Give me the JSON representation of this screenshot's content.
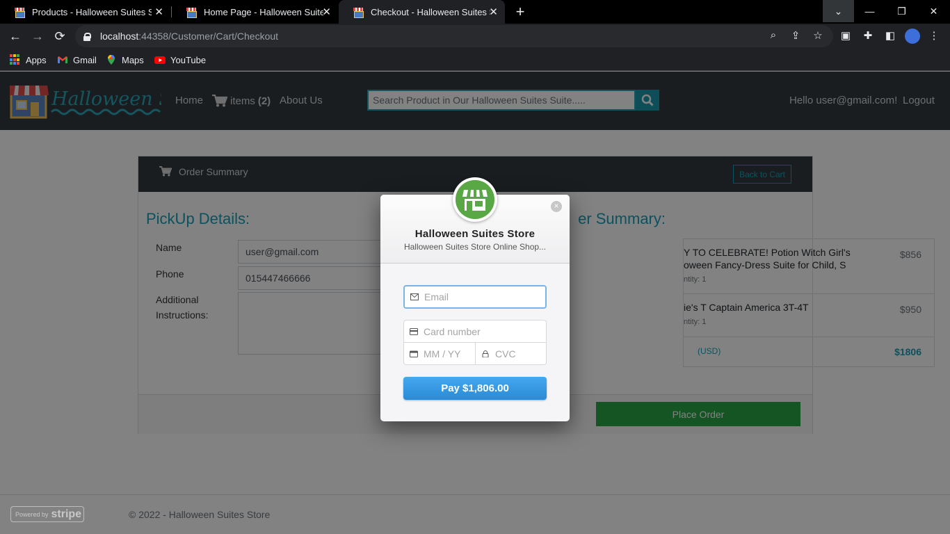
{
  "browser": {
    "tabs": [
      {
        "title": "Products - Halloween Suites Store"
      },
      {
        "title": "Home Page - Halloween Suites Store"
      },
      {
        "title": "Checkout - Halloween Suites Store"
      }
    ],
    "new_tab": "+",
    "window_controls": {
      "collapse": "⌄",
      "minimize": "—",
      "restore": "❐",
      "close": "✕"
    },
    "url_host": "localhost",
    "url_rest": ":44358/Customer/Cart/Checkout",
    "bookmarks": [
      {
        "label": "Apps",
        "icon": "apps-grid-icon"
      },
      {
        "label": "Gmail",
        "icon": "gmail-icon"
      },
      {
        "label": "Maps",
        "icon": "maps-pin-icon"
      },
      {
        "label": "YouTube",
        "icon": "youtube-icon"
      }
    ]
  },
  "site": {
    "brand": "Halloween Suites",
    "nav": {
      "home": "Home",
      "cart_label": "items",
      "cart_count": "(2)",
      "about": "About Us"
    },
    "search_placeholder": "Search Product in Our Halloween Suites Suite.....",
    "greeting": "Hello user@gmail.com!",
    "logout": "Logout"
  },
  "checkout": {
    "header_title": "Order Summary",
    "back_to_cart": "Back to Cart",
    "pickup_heading": "PickUp Details:",
    "summary_heading": "Order Summary:",
    "summary_heading_visible": "er Summary:",
    "fields": {
      "name_label": "Name",
      "name_value": "user@gmail.com",
      "phone_label": "Phone",
      "phone_value": "015447466666",
      "instructions_label_1": "Additional",
      "instructions_label_2": "Instructions:"
    },
    "items": [
      {
        "title_line1": "Y TO CELEBRATE! Potion Witch Girl's",
        "title_line2": "oween Fancy-Dress Suite for Child, S",
        "qty": "ntity: 1",
        "price": "$856"
      },
      {
        "title_line1": "ie's T Captain America 3T-4T",
        "title_line2": "",
        "qty": "ntity: 1",
        "price": "$950"
      }
    ],
    "total_label": "(USD)",
    "total_value": "$1806",
    "place_order": "Place Order"
  },
  "footer": {
    "copyright": "© 2022 - Halloween Suites Store",
    "powered_by": "Powered by",
    "stripe": "stripe"
  },
  "stripe_modal": {
    "store_name": "Halloween Suites Store",
    "store_desc": "Halloween Suites Store Online Shop...",
    "close": "×",
    "email_placeholder": "Email",
    "card_placeholder": "Card number",
    "expiry_placeholder": "MM / YY",
    "cvc_placeholder": "CVC",
    "pay_label": "Pay $1,806.00"
  },
  "colors": {
    "accent": "#17a2b8",
    "navbar": "#343a40",
    "place_order": "#28a745",
    "stripe_pay": "#2a8ad6",
    "store_logo": "#5aa845"
  }
}
